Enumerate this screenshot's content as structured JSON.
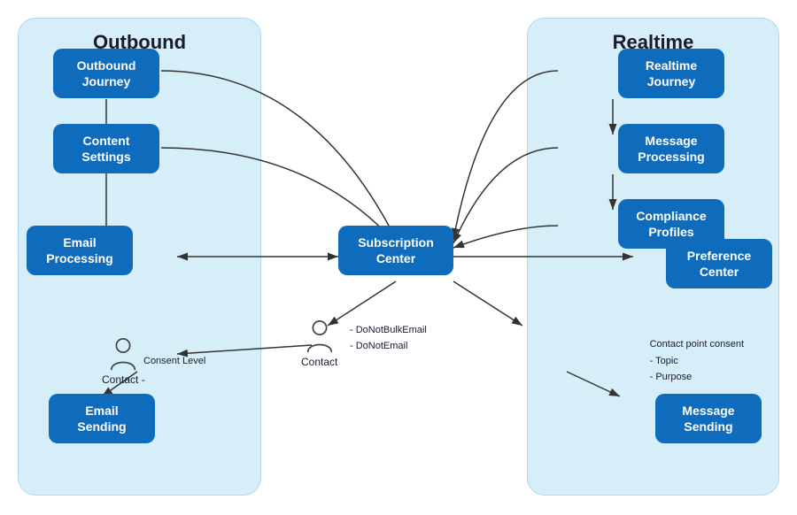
{
  "diagram": {
    "title_outbound": "Outbound",
    "title_realtime": "Realtime",
    "boxes": {
      "outbound_journey": "Outbound\nJourney",
      "content_settings": "Content\nSettings",
      "email_processing": "Email\nProcessing",
      "email_sending": "Email\nSending",
      "subscription_center": "Subscription\nCenter",
      "realtime_journey": "Realtime\nJourney",
      "message_processing": "Message\nProcessing",
      "compliance_profiles": "Compliance\nProfiles",
      "preference_center": "Preference\nCenter",
      "message_sending": "Message\nSending"
    },
    "contact_label": "Contact",
    "contact_left_label": "Contact -",
    "consent_level": "Consent Level",
    "contact_details_line1": "- DoNotBulkEmail",
    "contact_details_line2": "- DoNotEmail",
    "right_details_line0": "Contact point consent",
    "right_details_line1": "- Topic",
    "right_details_line2": "- Purpose"
  }
}
